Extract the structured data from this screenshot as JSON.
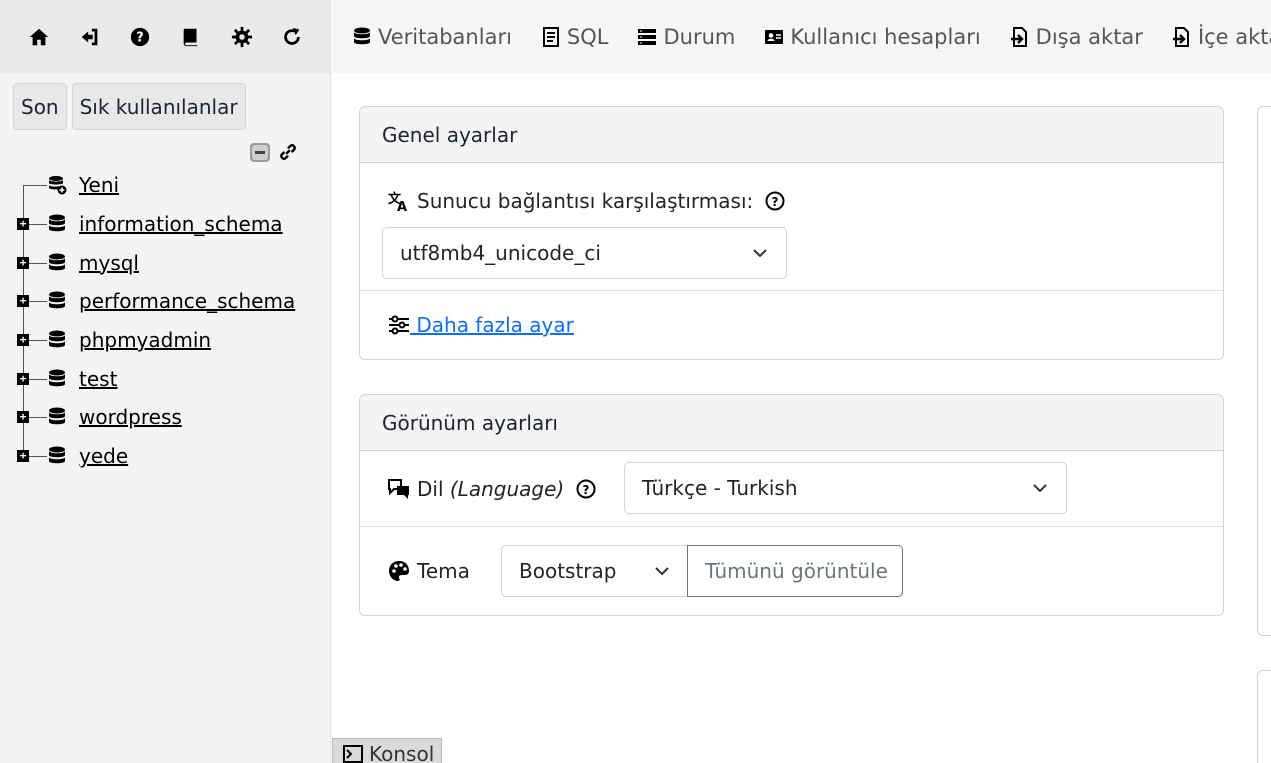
{
  "nav_icons": [
    "home-icon",
    "logout-icon",
    "help-icon",
    "docs-icon",
    "settings-icon",
    "reload-icon"
  ],
  "sidebar": {
    "recent_label": "Son",
    "favorites_label": "Sık kullanılanlar",
    "tree": [
      {
        "name": "Yeni",
        "new": true
      },
      {
        "name": "information_schema"
      },
      {
        "name": "mysql"
      },
      {
        "name": "performance_schema"
      },
      {
        "name": "phpmyadmin"
      },
      {
        "name": "test"
      },
      {
        "name": "wordpress"
      },
      {
        "name": "yede"
      }
    ]
  },
  "topmenu": {
    "tabs": [
      {
        "label": "Veritabanları",
        "icon": "database-icon"
      },
      {
        "label": "SQL",
        "icon": "sql-icon"
      },
      {
        "label": "Durum",
        "icon": "status-icon"
      },
      {
        "label": "Kullanıcı hesapları",
        "icon": "users-icon"
      },
      {
        "label": "Dışa aktar",
        "icon": "export-icon"
      },
      {
        "label": "İçe aktar",
        "icon": "import-icon"
      }
    ]
  },
  "general_settings": {
    "title": "Genel ayarlar",
    "collation_label": "Sunucu bağlantısı karşılaştırması:",
    "collation_value": "utf8mb4_unicode_ci",
    "more_settings": " Daha fazla ayar"
  },
  "appearance_settings": {
    "title": "Görünüm ayarları",
    "language_label": "Dil ",
    "language_label_italic": "(Language)",
    "language_value": "Türkçe - Turkish",
    "theme_label": "Tema",
    "theme_value": "Bootstrap",
    "theme_view_all": "Tümünü görüntüle"
  },
  "console": {
    "label": "Konsol"
  }
}
